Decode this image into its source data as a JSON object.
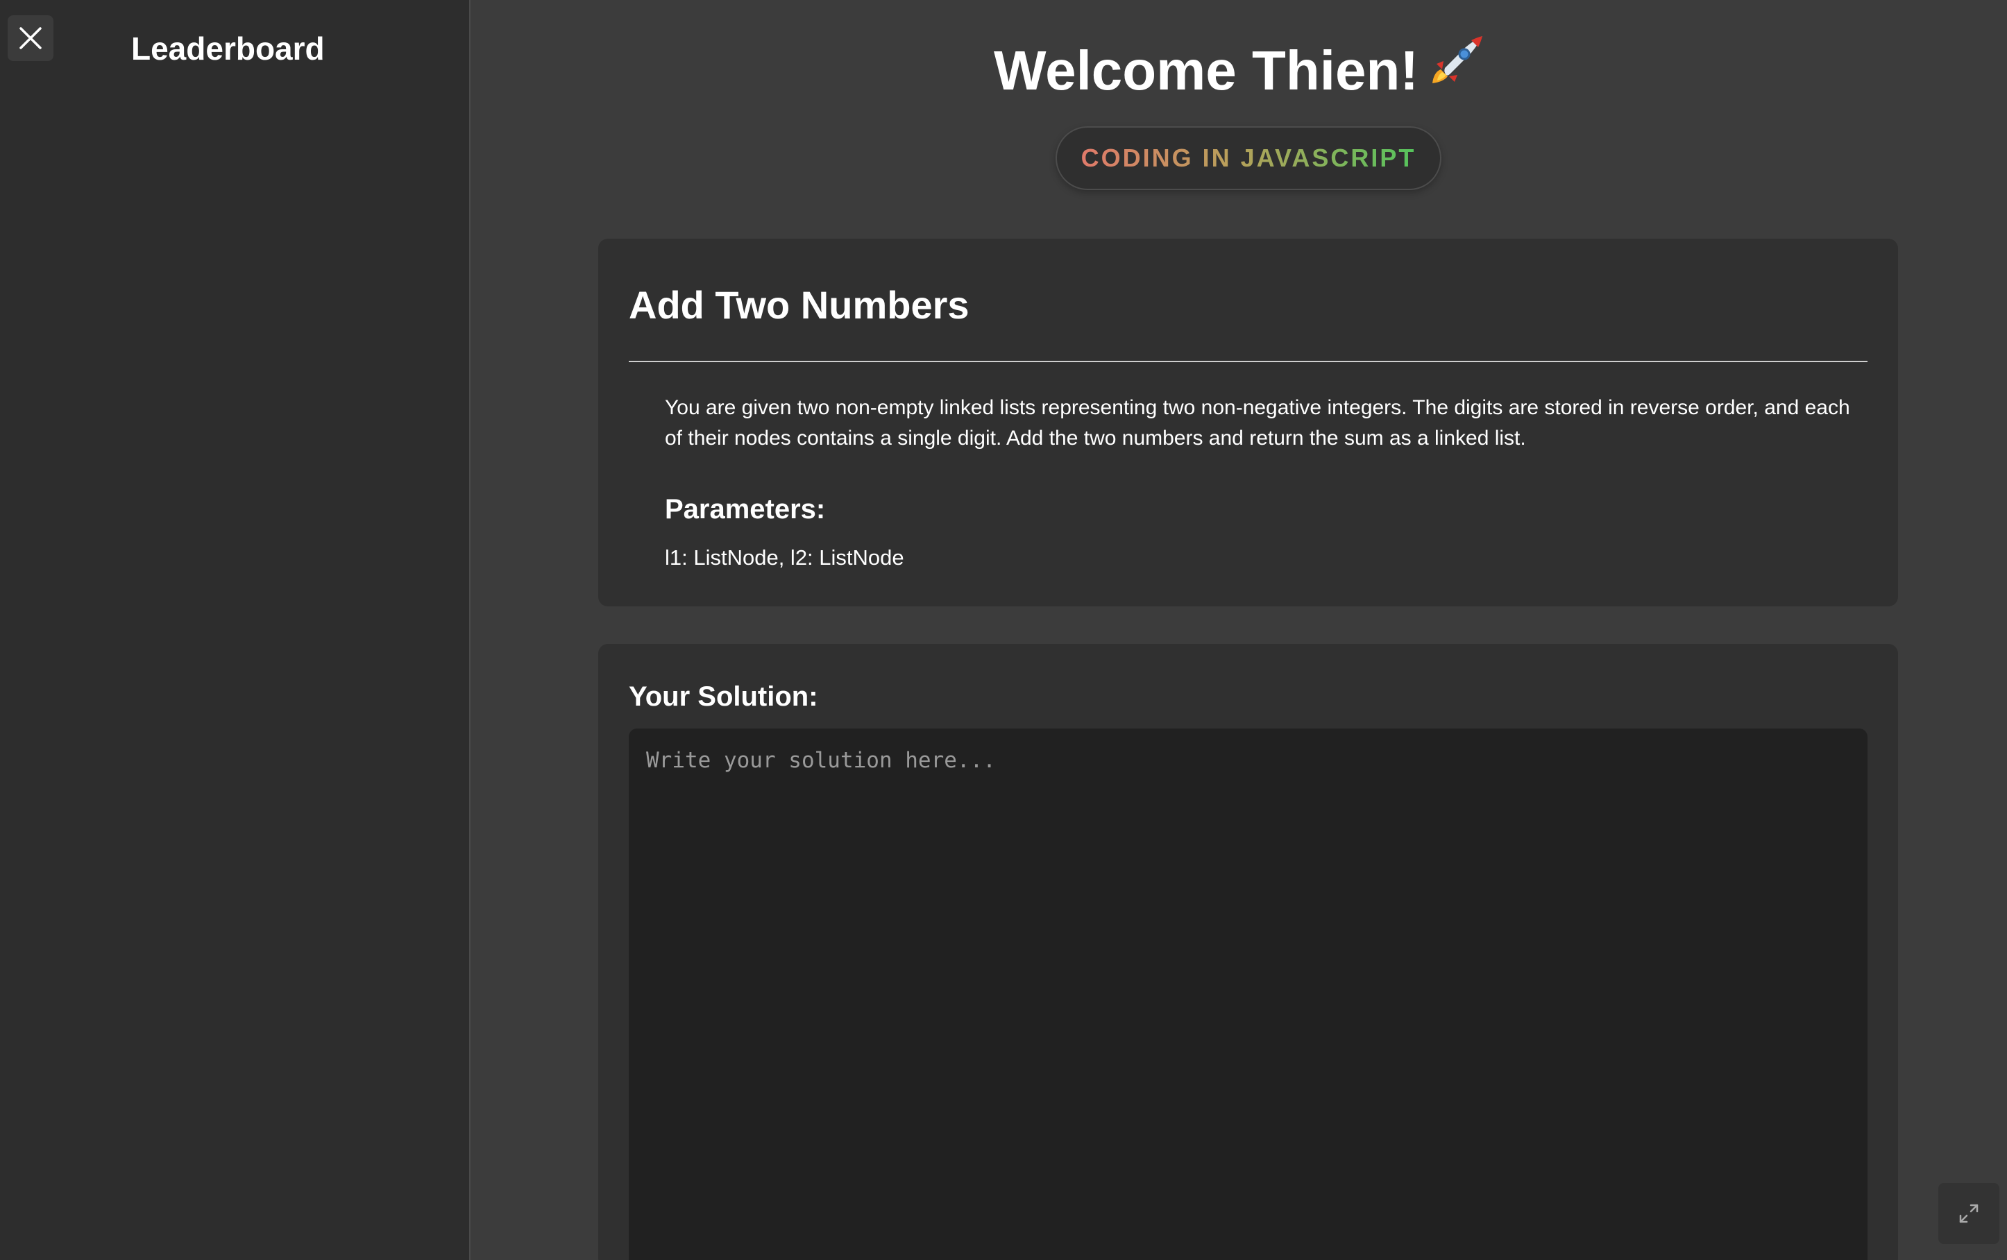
{
  "sidebar": {
    "title": "Leaderboard",
    "close_icon": "close-icon"
  },
  "header": {
    "welcome": "Welcome Thien!",
    "welcome_emoji": "rocket-icon",
    "language_badge": "CODING IN JAVASCRIPT"
  },
  "problem": {
    "title": "Add Two Numbers",
    "description": "You are given two non-empty linked lists representing two non-negative integers. The digits are stored in reverse order, and each of their nodes contains a single digit. Add the two numbers and return the sum as a linked list.",
    "parameters_heading": "Parameters:",
    "parameters": "l1: ListNode, l2: ListNode"
  },
  "solution": {
    "heading": "Your Solution:",
    "value": "",
    "placeholder": "Write your solution here..."
  },
  "controls": {
    "expand_icon": "expand-icon"
  },
  "colors": {
    "background": "#3c3c3c",
    "sidebar": "#2d2d2d",
    "card": "#303030",
    "editor": "#212121",
    "badge_gradient_start": "#e07a6a",
    "badge_gradient_end": "#55c45c"
  }
}
